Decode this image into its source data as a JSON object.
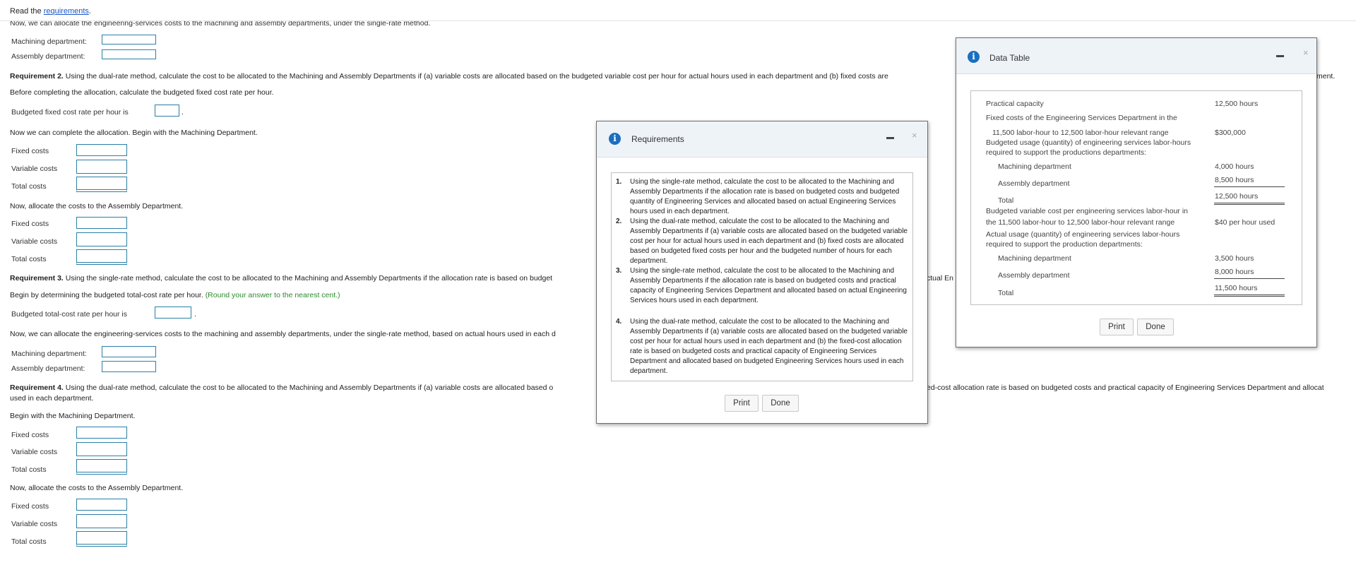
{
  "header": {
    "read_prefix": "Read the ",
    "requirements_link": "requirements",
    "read_suffix": "."
  },
  "main": {
    "line_single_rate_intro": "Now, we can allocate the engineering-services costs to the machining and assembly departments, under the single-rate method.",
    "machining_department_label": "Machining department:",
    "assembly_department_label": "Assembly department:",
    "req2_title": "Requirement 2.",
    "req2_text": " Using the dual-rate method, calculate the cost to be allocated to the Machining and Assembly Departments if (a) variable costs are allocated based on the budgeted variable cost per hour for actual hours used in each department and (b) fixed costs are",
    "req2_tail": "ment.",
    "before_completing": "Before completing the allocation, calculate the budgeted fixed cost rate per hour.",
    "budgeted_fixed_rate_label": "Budgeted fixed cost rate per hour is",
    "complete_allocation_machining": "Now we can complete the allocation. Begin with the Machining Department.",
    "fixed_costs": "Fixed costs",
    "variable_costs": "Variable costs",
    "total_costs": "Total costs",
    "allocate_assembly": "Now, allocate the costs to the Assembly Department.",
    "req3_title": "Requirement 3.",
    "req3_text": " Using the single-rate method, calculate the cost to be allocated to the Machining and Assembly Departments if the allocation rate is based on budget",
    "req3_tail": "ctual En",
    "begin_budgeted_total": "Begin by determining the budgeted total-cost rate per hour. ",
    "round_note": "(Round your answer to the nearest cent.)",
    "budgeted_total_rate_label": "Budgeted total-cost rate per hour is",
    "line_single_rate_actual": "Now, we can allocate the engineering-services costs to the machining and assembly departments, under the single-rate method, based on actual hours used in each d",
    "req4_title": "Requirement 4.",
    "req4_text": " Using the dual-rate method, calculate the cost to be allocated to the Machining and Assembly Departments if (a) variable costs are allocated based o",
    "req4_tail": "ed-cost allocation rate is based on budgeted costs and practical capacity of Engineering Services Department and allocat",
    "req4_line2": "used in each department.",
    "begin_machining": "Begin with the Machining Department.",
    "period": "."
  },
  "requirements_dialog": {
    "title": "Requirements",
    "items": [
      {
        "num": "1.",
        "text": "Using the single-rate method, calculate the cost to be allocated to the Machining and Assembly Departments if the allocation rate is based on budgeted costs and budgeted quantity of Engineering Services and allocated based on actual Engineering Services hours used in each department."
      },
      {
        "num": "2.",
        "text": "Using the dual-rate method, calculate the cost to be allocated to the Machining and Assembly Departments if (a) variable costs are allocated based on the budgeted variable cost per hour for actual hours used in each department and (b) fixed costs are allocated based on budgeted fixed costs per hour and the budgeted number of hours for each department."
      },
      {
        "num": "3.",
        "text": "Using the single-rate method, calculate the cost to be allocated to the Machining and Assembly Departments if the allocation rate is based on budgeted costs and practical capacity of Engineering Services Department and allocated based on actual Engineering Services hours used in each department."
      },
      {
        "num": "4.",
        "text": "Using the dual-rate method, calculate the cost to be allocated to the Machining and Assembly Departments if (a) variable costs are allocated based on the budgeted variable cost per hour for actual hours used in each department and (b) the fixed-cost allocation rate is based on budgeted costs and practical capacity of Engineering Services Department and allocated based on budgeted Engineering Services hours used in each department."
      }
    ],
    "print_label": "Print",
    "done_label": "Done",
    "close_glyph": "×"
  },
  "data_table_dialog": {
    "title": "Data Table",
    "rows": {
      "practical_capacity": "Practical capacity",
      "practical_capacity_val": "12,500 hours",
      "fixed_costs_line1": "Fixed costs of the Engineering Services Department in the",
      "fixed_costs_line2": "11,500 labor-hour to 12,500 labor-hour relevant range",
      "fixed_costs_val": "$300,000",
      "budgeted_usage_line1": "Budgeted usage (quantity) of engineering services labor-hours",
      "budgeted_usage_line2": "required to support the productions departments:",
      "machining_department": "Machining department",
      "budget_machining_val": "4,000 hours",
      "assembly_department": "Assembly department",
      "budget_assembly_val": "8,500 hours",
      "total": "Total",
      "budget_total_val": "12,500 hours",
      "budgeted_variable_line1": "Budgeted variable cost per engineering services labor-hour in",
      "budgeted_variable_line2": "the 11,500 labor-hour to 12,500 labor-hour relevant range",
      "budgeted_variable_val": "$40 per hour used",
      "actual_usage_line1": "Actual usage (quantity) of engineering services labor-hours",
      "actual_usage_line2": "required to support the production departments:",
      "actual_machining_val": "3,500 hours",
      "actual_assembly_val": "8,000 hours",
      "actual_total_val": "11,500 hours"
    },
    "print_label": "Print",
    "done_label": "Done",
    "close_glyph": "×"
  }
}
